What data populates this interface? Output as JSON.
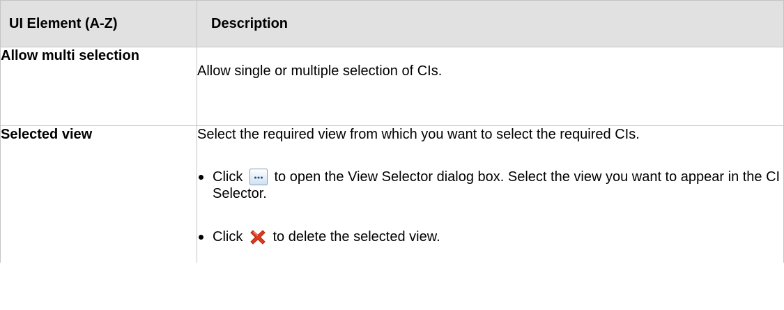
{
  "table": {
    "headers": {
      "col1": "UI Element (A-Z)",
      "col2": "Description"
    },
    "rows": [
      {
        "name": "Allow multi selection",
        "description": "Allow single or multiple selection of CIs."
      },
      {
        "name": "Selected view",
        "description": "Select the required view from which you want to select the required CIs.",
        "bullets": [
          {
            "pre": "Click",
            "icon": "ellipsis-button-icon",
            "post": "to open the View Selector dialog box. Select the view you want to appear in the CI Selector."
          },
          {
            "pre": "Click",
            "icon": "red-x-delete-icon",
            "post": "to delete the selected view."
          }
        ]
      }
    ]
  },
  "colors": {
    "header_bg": "#e1e1e1",
    "border": "#c4c4c4",
    "delete_icon": "#e03a1e"
  }
}
